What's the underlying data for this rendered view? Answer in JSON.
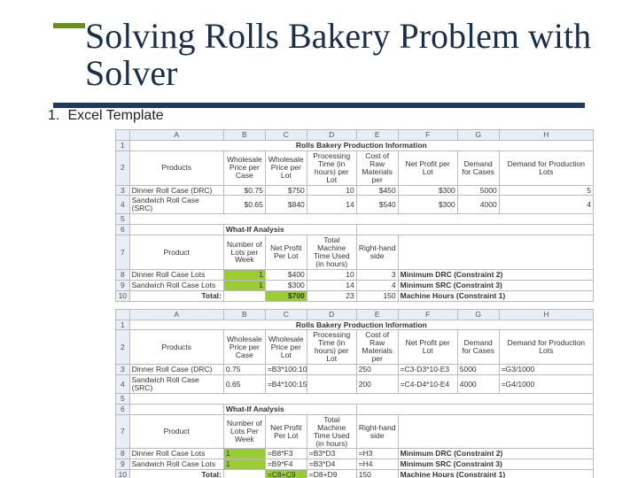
{
  "title": "Solving Rolls Bakery Problem with Solver",
  "bullet": {
    "num": "1.",
    "text": "Excel Template"
  },
  "cols": [
    "A",
    "B",
    "C",
    "D",
    "E",
    "F",
    "G",
    "H"
  ],
  "sheet1": {
    "merge_title": "Rolls Bakery Production Information",
    "r2": {
      "A": "Products",
      "B": "Wholesale Price per Case",
      "C": "Wholesale Price per Lot",
      "D": "Processing Time (in hours) per Lot",
      "E": "Cost of Raw Materials per",
      "F": "Net Profit per Lot",
      "G": "Demand for Cases",
      "H": "Demand for Production Lots"
    },
    "r3": {
      "A": "Dinner Roll Case (DRC)",
      "B": "$0.75",
      "C": "$750",
      "D": "10",
      "E": "$450",
      "F": "$300",
      "G": "5000",
      "H": "5"
    },
    "r4": {
      "A": "Sandwich Roll Case (SRC)",
      "B": "$0.65",
      "C": "$840",
      "D": "14",
      "E": "$540",
      "F": "$300",
      "G": "4000",
      "H": "4"
    },
    "wi_title": "What-If Analysis",
    "r7": {
      "A": "Product",
      "B": "Number of Lots per Week",
      "C": "Net Profit Per Lot",
      "D": "Total Machine Time Used (in hours)",
      "E": "Right-hand side"
    },
    "r8": {
      "A": "Dinner Roll Case Lots",
      "B": "1",
      "C": "$400",
      "D": "10",
      "E": "3",
      "F": "Minimum DRC (Constraint 2)"
    },
    "r9": {
      "A": "Sandwich Roll Case Lots",
      "B": "1",
      "C": "$300",
      "D": "14",
      "E": "4",
      "F": "Minimum SRC (Constraint 3)"
    },
    "r10": {
      "A": "Total:",
      "C": "$700",
      "D": "23",
      "E": "150",
      "F": "Machine Hours (Constraint 1)"
    }
  },
  "sheet2": {
    "merge_title": "Rolls Bakery Production Information",
    "r2": {
      "A": "Products",
      "B": "Wholesale Price per Case",
      "C": "Wholesale Price per Lot",
      "D": "Processing Time (in hours) per Lot",
      "E": "Cost of Raw Materials per",
      "F": "Net Profit per Lot",
      "G": "Demand for Cases",
      "H": "Demand for Production Lots"
    },
    "r3": {
      "A": "Dinner Roll Case (DRC)",
      "B": "0.75",
      "C": "=B3*100:10",
      "D": "",
      "E": "250",
      "F": "=C3-D3*10-E3",
      "G": "5000",
      "H": "=G3/1000"
    },
    "r4": {
      "A": "Sandwich Roll Case (SRC)",
      "B": "0.65",
      "C": "=B4*100:15",
      "D": "",
      "E": "200",
      "F": "=C4-D4*10-E4",
      "G": "4000",
      "H": "=G4/1000"
    },
    "wi_title": "What-If Analysis",
    "r7": {
      "A": "Product",
      "B": "Number of Lots Per Week",
      "C": "Net Profit Per Lot",
      "D": "Total Machine Time Used (in hours)",
      "E": "Right-hand side"
    },
    "r8": {
      "A": "Dinner Roll Case Lots",
      "B": "1",
      "C": "=B8*F3",
      "D": "=B3*D3",
      "E": "=H3",
      "F": "Minimum DRC (Constraint 2)"
    },
    "r9": {
      "A": "Sandwich Roll Case Lots",
      "B": "1",
      "C": "=B9*F4",
      "D": "=B3*D4",
      "E": "=H4",
      "F": "Minimum SRC (Constraint 3)"
    },
    "r10": {
      "A": "Total:",
      "C": "=C8+C9",
      "D": "=D8+D9",
      "E": "150",
      "F": "Machine Hours (Constraint 1)"
    }
  }
}
